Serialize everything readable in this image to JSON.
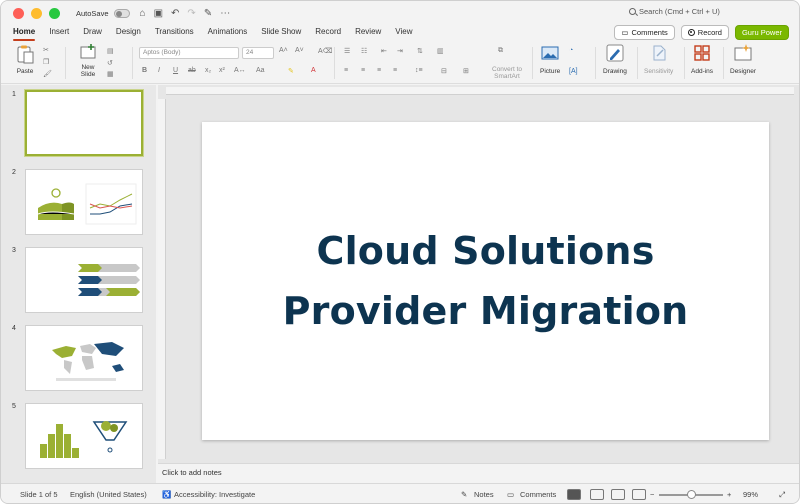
{
  "titlebar": {
    "autosave_label": "AutoSave",
    "search_placeholder": "Search (Cmd + Ctrl + U)"
  },
  "tabs": [
    "Home",
    "Insert",
    "Draw",
    "Design",
    "Transitions",
    "Animations",
    "Slide Show",
    "Record",
    "Review",
    "View"
  ],
  "top_buttons": {
    "comments": "Comments",
    "record": "Record",
    "guru": "Guru Power"
  },
  "ribbon": {
    "paste": "Paste",
    "new_slide_1": "New",
    "new_slide_2": "Slide",
    "font_name": "Aptos (Body)",
    "font_size": "24",
    "convert_1": "Convert to",
    "convert_2": "SmartArt",
    "picture": "Picture",
    "drawing": "Drawing",
    "sensitivity": "Sensitivity",
    "addins": "Add-ins",
    "designer": "Designer"
  },
  "thumbnails": [
    "1",
    "2",
    "3",
    "4",
    "5"
  ],
  "slide": {
    "title_line1": "Cloud Solutions",
    "title_line2": "Provider Migration"
  },
  "notes_placeholder": "Click to add notes",
  "status": {
    "slide_counter": "Slide 1 of 5",
    "language": "English (United States)",
    "accessibility": "Accessibility: Investigate",
    "notes": "Notes",
    "comments": "Comments",
    "zoom": "99%"
  },
  "colors": {
    "accent_tab": "#c43e1c",
    "title_text": "#0d3450",
    "guru_button": "#7ab800",
    "chart_green": "#9bb034",
    "chart_blue": "#1f4e79"
  }
}
